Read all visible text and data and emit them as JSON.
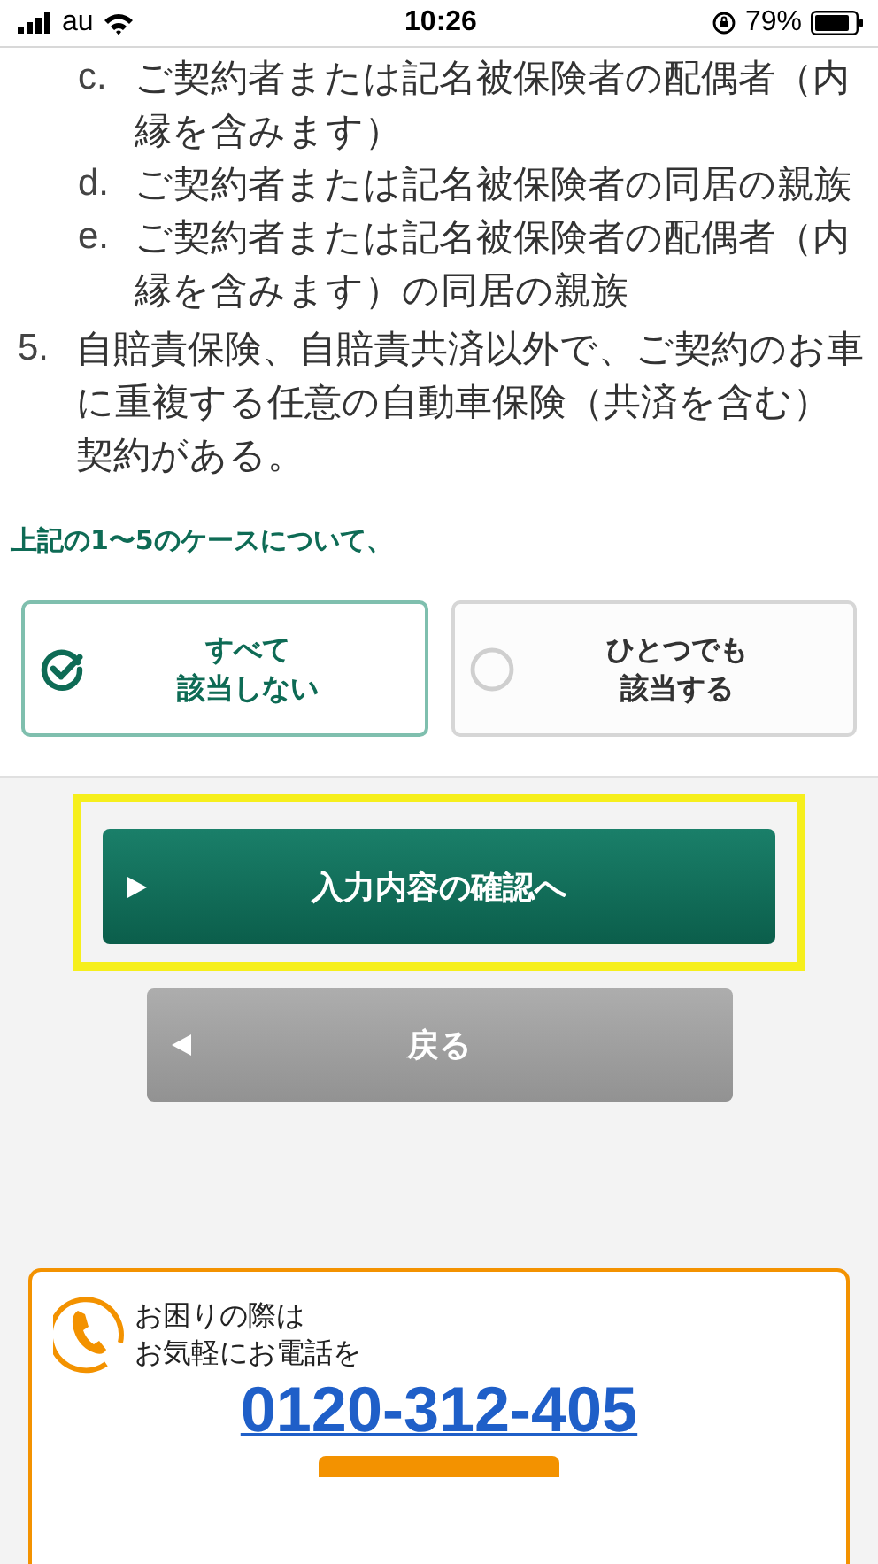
{
  "status_bar": {
    "carrier": "au",
    "time": "10:26",
    "battery": "79%"
  },
  "sub_items": [
    {
      "label": "c.",
      "text": "ご契約者または記名被保険者の配偶者（内縁を含みます）"
    },
    {
      "label": "d.",
      "text": "ご契約者または記名被保険者の同居の親族"
    },
    {
      "label": "e.",
      "text": "ご契約者または記名被保険者の配偶者（内縁を含みます）の同居の親族"
    }
  ],
  "items": [
    {
      "label": "5.",
      "text": "自賠責保険、自賠責共済以外で、ご契約のお車に重複する任意の自動車保険（共済を含む）契約がある。"
    }
  ],
  "question": "上記の1〜5のケースについて、",
  "options": [
    {
      "lines": [
        "すべて",
        "該当しない"
      ],
      "selected": true
    },
    {
      "lines": [
        "ひとつでも",
        "該当する"
      ],
      "selected": false
    }
  ],
  "buttons": [
    {
      "kind": "primary",
      "label": "入力内容の確認へ",
      "highlighted": true
    },
    {
      "kind": "back",
      "label": "戻る",
      "highlighted": false
    }
  ],
  "contact": {
    "lines": [
      "お困りの際は",
      "お気軽にお電話を"
    ],
    "phone": "0120-312-405"
  }
}
